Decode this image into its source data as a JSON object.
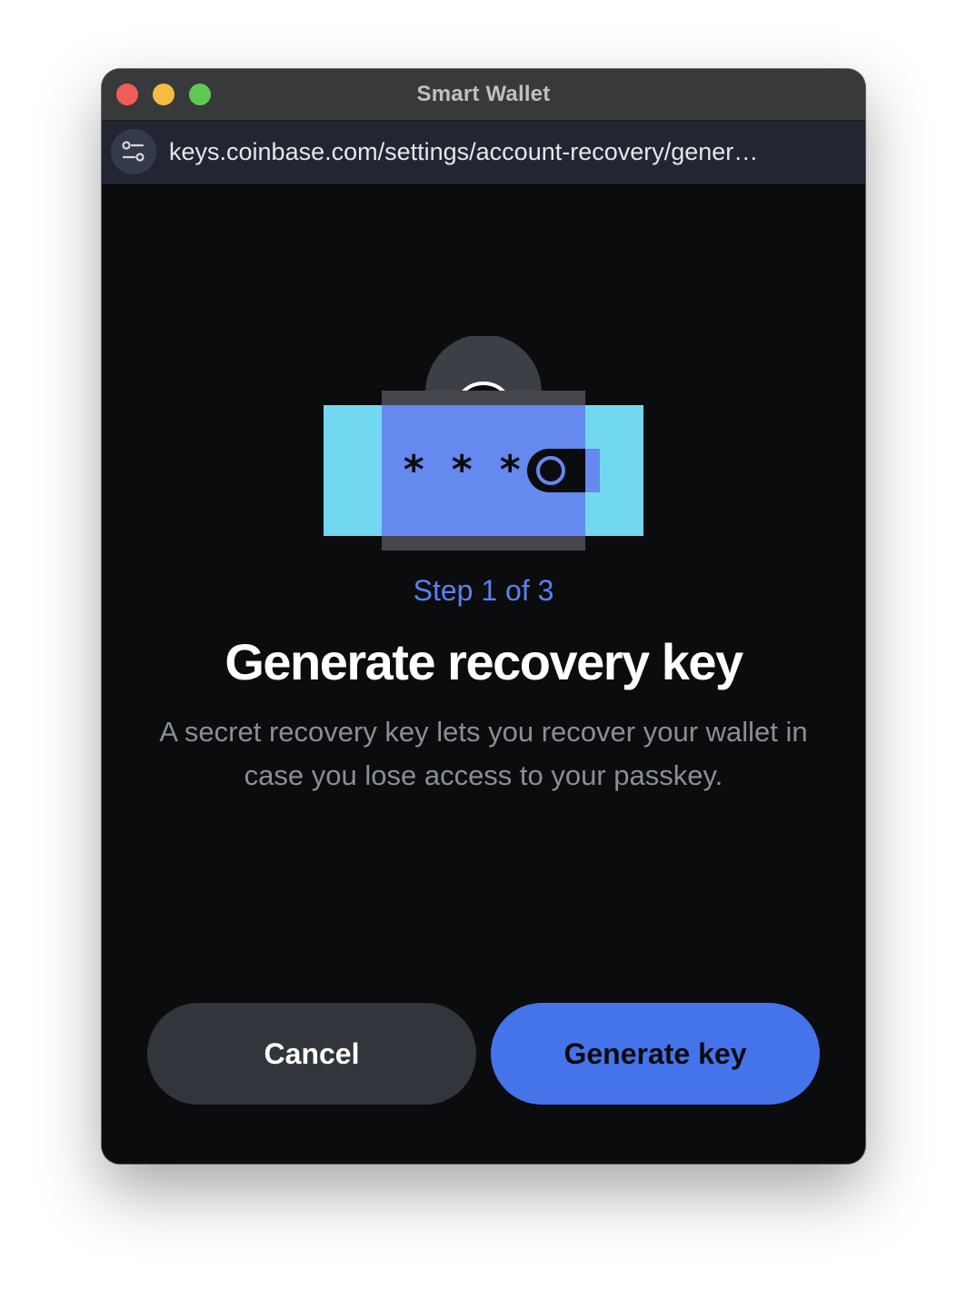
{
  "window": {
    "title": "Smart Wallet"
  },
  "address_bar": {
    "url": "keys.coinbase.com/settings/account-recovery/gener…",
    "settings_icon": "page-settings-icon"
  },
  "illustration": {
    "icon": "padlock-password-icon",
    "masked_text": "* * *",
    "colors": {
      "shackle": "#3c3f46",
      "cyan": "#72d7f0",
      "blue": "#6589ee",
      "dark": "#0b0c0e"
    }
  },
  "main": {
    "step_label": "Step 1 of 3",
    "title": "Generate recovery key",
    "description": "A secret recovery key lets you recover your wallet in case you lose access to your passkey."
  },
  "actions": {
    "cancel_label": "Cancel",
    "primary_label": "Generate key"
  },
  "colors": {
    "accent": "#4573ea",
    "step_text": "#5b81f0",
    "background": "#0b0c0e",
    "secondary_button": "#32353c"
  }
}
